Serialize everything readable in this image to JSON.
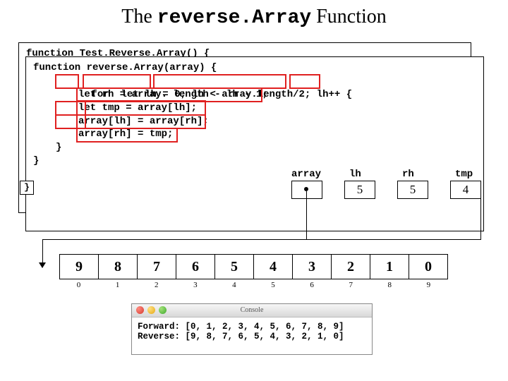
{
  "title_prefix": "The ",
  "title_code": "reverse.Array",
  "title_suffix": " Function",
  "back_code": {
    "l1": "function Test.Reverse.Array() {"
  },
  "code": {
    "l1": "function reverse.Array(array) {",
    "l2_for": "for",
    "l2_init": "let lh = 0;",
    "l2_cond": "lh < array.length/2;",
    "l2_inc": "lh++",
    "l2_close": " {",
    "l3": "let rh = array. length - lh - 1;",
    "l4": "let tmp = array[lh];",
    "l5": "array[lh] = array[rh];",
    "l6": "array[rh] = tmp;",
    "l7": "}",
    "l8": "}"
  },
  "vars": {
    "array_label": "array",
    "lh_label": "lh",
    "rh_label": "rh",
    "tmp_label": "tmp",
    "lh_value": "5",
    "rh_value": "5",
    "tmp_value": "4"
  },
  "array_cells": [
    "9",
    "8",
    "7",
    "6",
    "5",
    "4",
    "3",
    "2",
    "1",
    "0"
  ],
  "array_indices": [
    "0",
    "1",
    "2",
    "3",
    "4",
    "5",
    "6",
    "7",
    "8",
    "9"
  ],
  "console": {
    "title": "Console",
    "line1": "Forward: [0, 1, 2, 3, 4, 5, 6, 7, 8, 9]",
    "line2": "Reverse: [9, 8, 7, 6, 5, 4, 3, 2, 1, 0]"
  }
}
